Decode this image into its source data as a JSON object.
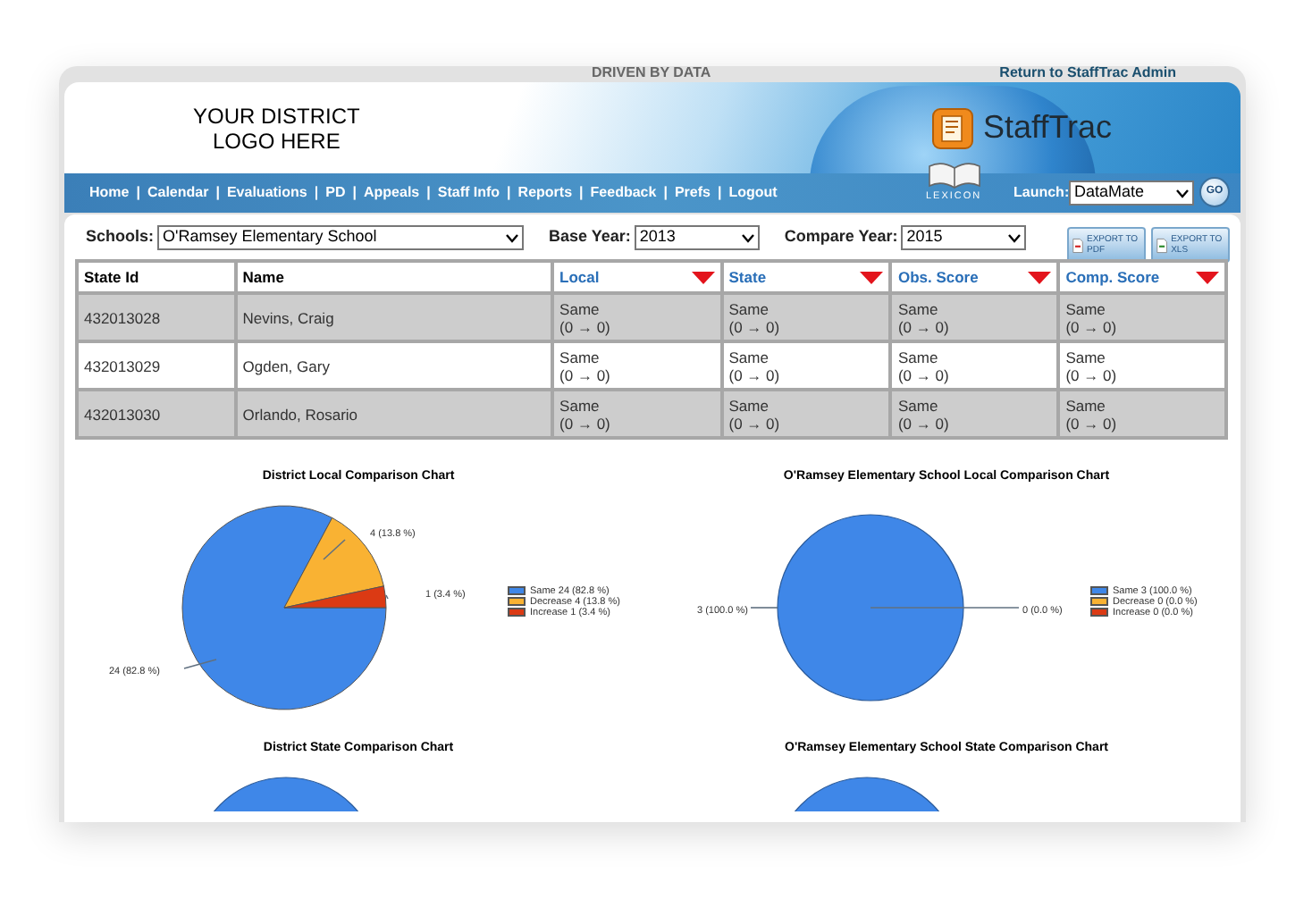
{
  "top_bar": {
    "tagline": "DRIVEN BY DATA",
    "admin_link": "Return to StaffTrac Admin"
  },
  "header": {
    "district_logo": "YOUR DISTRICT\nLOGO HERE",
    "brand": "StaffTrac",
    "lexicon": "LEXICON"
  },
  "nav": {
    "items": [
      "Home",
      "Calendar",
      "Evaluations",
      "PD",
      "Appeals",
      "Staff Info",
      "Reports",
      "Feedback",
      "Prefs",
      "Logout"
    ],
    "separator": "|",
    "launch_label": "Launch:",
    "launch_value": "DataMate",
    "go": "GO"
  },
  "filters": [
    {
      "label": "Schools:",
      "value": "O'Ramsey Elementary School"
    },
    {
      "label": "Base Year:",
      "value": "2013"
    },
    {
      "label": "Compare Year:",
      "value": "2015"
    }
  ],
  "exports": [
    {
      "label": "EXPORT TO PDF",
      "kind": "pdf"
    },
    {
      "label": "EXPORT TO XLS",
      "kind": "xls"
    }
  ],
  "table": {
    "columns": [
      {
        "label": "State Id",
        "sortable": false
      },
      {
        "label": "Name",
        "sortable": false
      },
      {
        "label": "Local",
        "sortable": true
      },
      {
        "label": "State",
        "sortable": true
      },
      {
        "label": "Obs. Score",
        "sortable": true
      },
      {
        "label": "Comp. Score",
        "sortable": true
      }
    ],
    "rows": [
      {
        "shaded": true,
        "cells": [
          "432013028",
          "Nevins, Craig",
          "Same\n(0 → 0)",
          "Same\n(0 → 0)",
          "Same\n(0 → 0)",
          "Same\n(0 → 0)"
        ]
      },
      {
        "shaded": false,
        "cells": [
          "432013029",
          "Ogden, Gary",
          "Same\n(0 → 0)",
          "Same\n(0 → 0)",
          "Same\n(0 → 0)",
          "Same\n(0 → 0)"
        ]
      },
      {
        "shaded": true,
        "cells": [
          "432013030",
          "Orlando, Rosario",
          "Same\n(0 → 0)",
          "Same\n(0 → 0)",
          "Same\n(0 → 0)",
          "Same\n(0 → 0)"
        ]
      }
    ]
  },
  "charts": [
    {
      "chart_data": {
        "type": "pie",
        "title": "District Local Comparison Chart",
        "series": [
          {
            "values": [
              82.8,
              13.8,
              3.4
            ]
          }
        ],
        "value_labels": [
          "24 (82.8 %)",
          "4 (13.8 %)",
          "1 (3.4 %)"
        ]
      },
      "legend": [
        {
          "label": "Same 24 (82.8 %)",
          "color": "#3f87e8"
        },
        {
          "label": "Decrease 4 (13.8 %)",
          "color": "#f9b233"
        },
        {
          "label": "Increase 1 (3.4 %)",
          "color": "#db3a14"
        }
      ]
    },
    {
      "chart_data": {
        "type": "pie",
        "title": "O'Ramsey Elementary School Local Comparison Chart",
        "series": [
          {
            "values": [
              100,
              0,
              0
            ]
          }
        ],
        "value_labels": [
          "3 (100.0 %)",
          "0 (0.0 %)"
        ]
      },
      "legend": [
        {
          "label": "Same 3 (100.0 %)",
          "color": "#3f87e8"
        },
        {
          "label": "Decrease 0 (0.0 %)",
          "color": "#f9b233"
        },
        {
          "label": "Increase 0 (0.0 %)",
          "color": "#db3a14"
        }
      ]
    },
    {
      "title": "District State Comparison Chart"
    },
    {
      "title": "O'Ramsey Elementary School State Comparison Chart"
    }
  ]
}
